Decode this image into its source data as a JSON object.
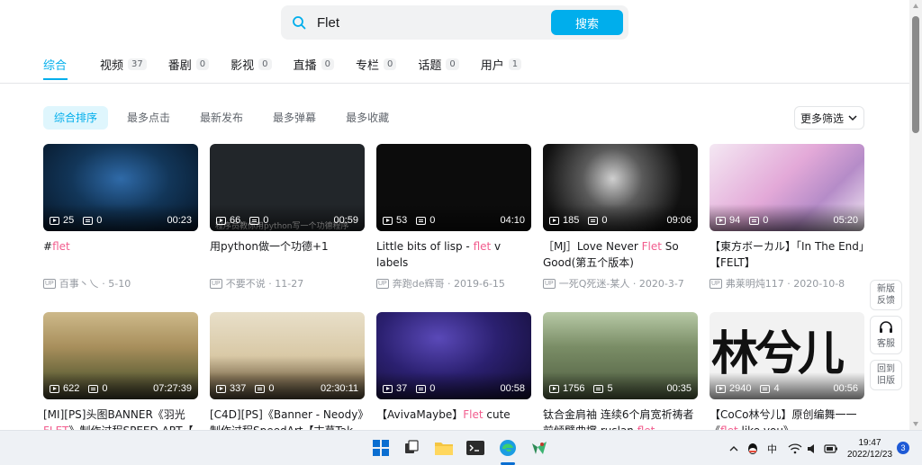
{
  "search": {
    "value": "Flet",
    "button_label": "搜索"
  },
  "tabs": [
    {
      "label": "综合",
      "count": ""
    },
    {
      "label": "视频",
      "count": "37"
    },
    {
      "label": "番剧",
      "count": "0"
    },
    {
      "label": "影视",
      "count": "0"
    },
    {
      "label": "直播",
      "count": "0"
    },
    {
      "label": "专栏",
      "count": "0"
    },
    {
      "label": "话题",
      "count": "0"
    },
    {
      "label": "用户",
      "count": "1"
    }
  ],
  "filters": [
    "综合排序",
    "最多点击",
    "最新发布",
    "最多弹幕",
    "最多收藏"
  ],
  "more_filter": "更多筛选",
  "cards": [
    {
      "plays": "25",
      "danmaku": "0",
      "duration": "00:23",
      "title_pre": "#",
      "title_hl": "flet",
      "title_post": "",
      "author": "百事丶乀",
      "date": "5-10"
    },
    {
      "plays": "66",
      "danmaku": "0",
      "duration": "00:59",
      "title_pre": "用python做一个功德+1",
      "title_hl": "",
      "title_post": "",
      "author": "不要不说",
      "date": "11-27",
      "overlay": "程序员教你用python写一个功德程序"
    },
    {
      "plays": "53",
      "danmaku": "0",
      "duration": "04:10",
      "title_pre": "Little bits of lisp - ",
      "title_hl": "flet",
      "title_post": " v labels",
      "author": "奔跑de辉哥",
      "date": "2019-6-15"
    },
    {
      "plays": "185",
      "danmaku": "0",
      "duration": "09:06",
      "title_pre": "［MJ］Love Never ",
      "title_hl": "Flet",
      "title_post": " So Good(第五个版本)",
      "author": "一死Q死迷-某人",
      "date": "2020-3-7"
    },
    {
      "plays": "94",
      "danmaku": "0",
      "duration": "05:20",
      "title_pre": "【東方ボーカル】「In The End」【FELT】",
      "title_hl": "",
      "title_post": "",
      "author": "弗莱明炖117",
      "date": "2020-10-8"
    },
    {
      "plays": "622",
      "danmaku": "0",
      "duration": "07:27:39",
      "title_pre": "[MI][PS]头图BANNER《羽光",
      "title_hl": "FLET",
      "title_post": "》制作过程SPEED ART【",
      "author": "",
      "date": ""
    },
    {
      "plays": "337",
      "danmaku": "0",
      "duration": "02:30:11",
      "title_pre": "[C4D][PS]《Banner - Neody》制作过程SpeedArt【末草Tak",
      "title_hl": "",
      "title_post": "",
      "author": "",
      "date": ""
    },
    {
      "plays": "37",
      "danmaku": "0",
      "duration": "00:58",
      "title_pre": "【AvivaMaybe】",
      "title_hl": "Flet",
      "title_post": " cute",
      "author": "",
      "date": ""
    },
    {
      "plays": "1756",
      "danmaku": "5",
      "duration": "00:35",
      "title_pre": "钛合金肩袖 连续6个肩宽祈祷者前倾臂曲撑 ruslan ",
      "title_hl": "flet",
      "title_post": "",
      "author": "",
      "date": ""
    },
    {
      "plays": "2940",
      "danmaku": "4",
      "duration": "00:56",
      "title_pre": "【CoCo林兮儿】原创编舞一一《",
      "title_hl": "flet",
      "title_post": " like you》",
      "author": "",
      "date": "",
      "overlay": "林兮儿"
    }
  ],
  "side_buttons": [
    "新版反馈",
    "客服",
    "回到旧版"
  ],
  "taskbar": {
    "time": "19:47",
    "date": "2022/12/23",
    "ime": "中",
    "notifications": "3"
  }
}
